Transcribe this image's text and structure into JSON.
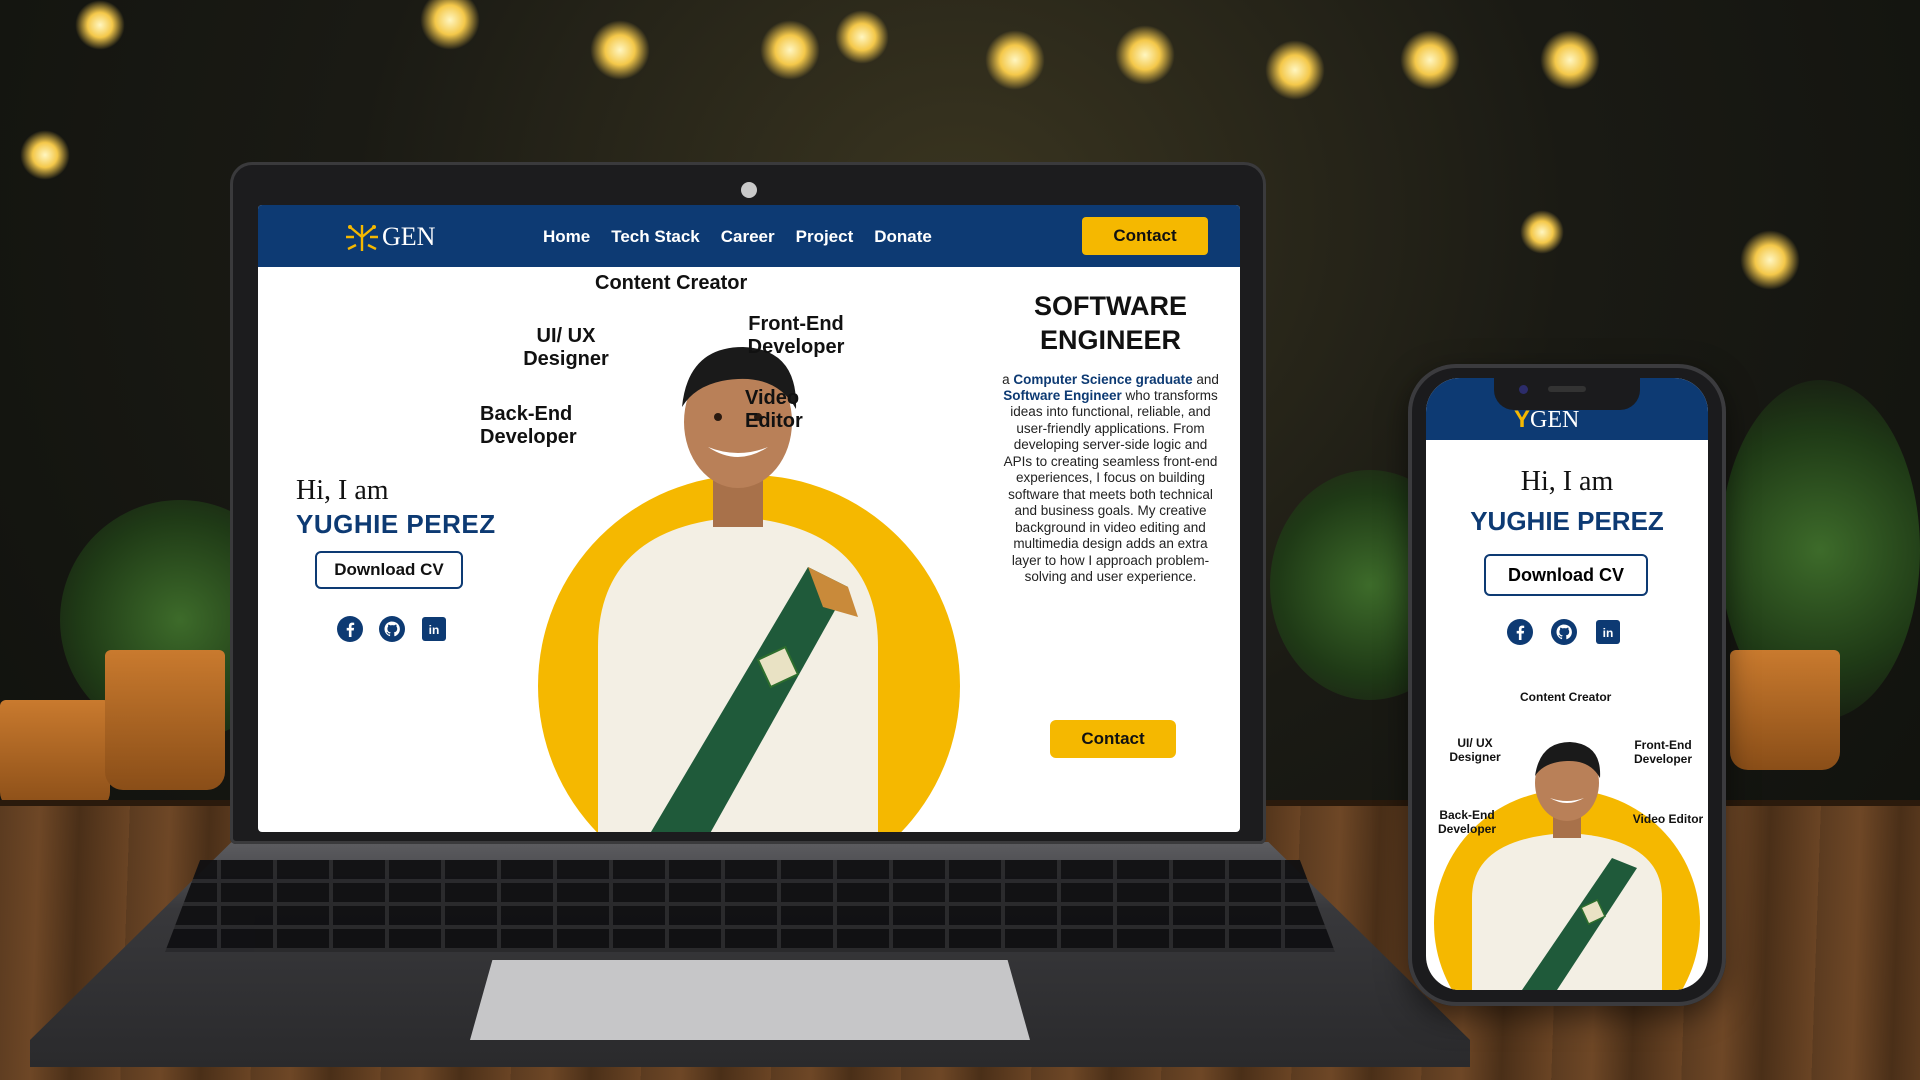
{
  "site": {
    "logo_text": "GEN",
    "nav": [
      "Home",
      "Tech Stack",
      "Career",
      "Project",
      "Donate"
    ],
    "nav_contact": "Contact",
    "greeting": "Hi, I am",
    "name": "YUGHIE PEREZ",
    "download_cv": "Download CV",
    "socials": [
      "facebook-icon",
      "github-icon",
      "linkedin-icon"
    ],
    "roles": {
      "content_creator": "Content Creator",
      "ui_ux_line1": "UI/ UX",
      "ui_ux_line2": "Designer",
      "frontend_line1": "Front-End",
      "frontend_line2": "Developer",
      "video_line1": "Video",
      "video_line2": "Editor",
      "backend_line1": "Back-End",
      "backend_line2": "Developer"
    },
    "about_title_line1": "SOFTWARE",
    "about_title_line2": "ENGINEER",
    "about_prefix": "a ",
    "about_hl1": "Computer Science graduate",
    "about_mid": " and ",
    "about_hl2": "Software Engineer",
    "about_body": " who transforms ideas into functional, reliable, and user-friendly applications. From developing server-side logic and APIs to creating seamless front-end experiences, I focus on building software that meets both technical and business goals. My creative background in video editing and multimedia design adds an extra layer to how I approach problem-solving and user experience.",
    "about_contact": "Contact"
  },
  "mobile": {
    "logo_text": "GEN",
    "greeting": "Hi, I am",
    "name": "YUGHIE PEREZ",
    "download_cv": "Download CV",
    "roles": {
      "content_creator": "Content Creator",
      "ui_ux_line1": "UI/ UX",
      "ui_ux_line2": "Designer",
      "frontend_line1": "Front-End",
      "frontend_line2": "Developer",
      "backend_line1": "Back-End",
      "backend_line2": "Developer",
      "video_editor": "Video Editor"
    }
  },
  "colors": {
    "navy": "#0d3a73",
    "gold": "#f5b800"
  }
}
